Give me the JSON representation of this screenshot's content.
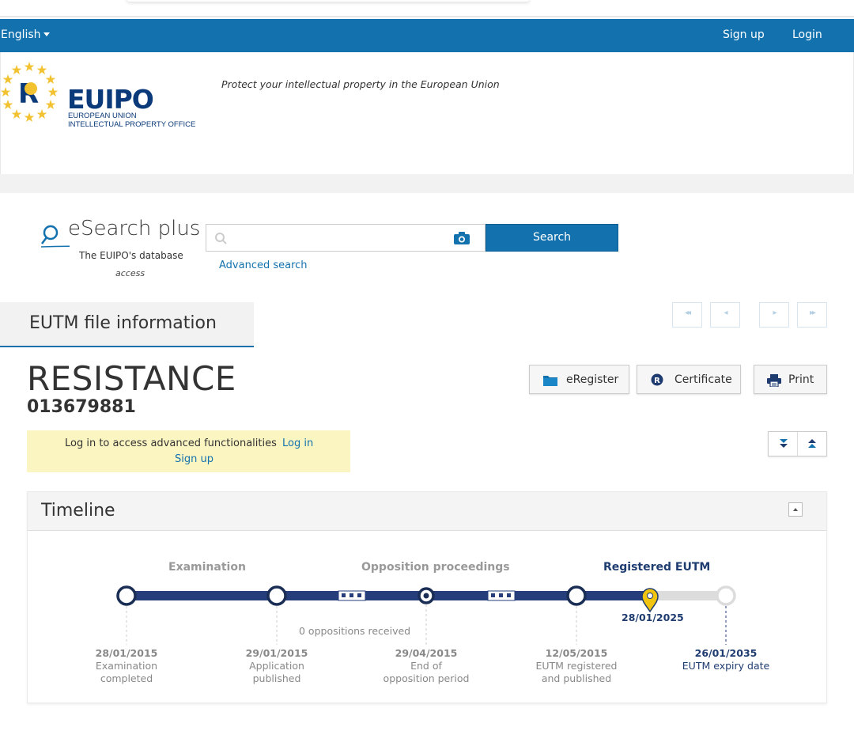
{
  "nav": {
    "language": "English",
    "signup": "Sign up",
    "login": "Login"
  },
  "header": {
    "logo_big_eu": "EU",
    "logo_big_ipo": "IPO",
    "logo_line1": "EUROPEAN UNION",
    "logo_line2": "INTELLECTUAL PROPERTY OFFICE",
    "tagline": "Protect your intellectual property in the European Union"
  },
  "search": {
    "product_title": "eSearch plus",
    "subtitle1": "The EUIPO's database",
    "subtitle2": "access",
    "input_value": "",
    "input_placeholder": "",
    "button_label": "Search",
    "advanced_link": "Advanced search"
  },
  "file": {
    "tab_label": "EUTM file information",
    "name": "RESISTANCE",
    "number": "013679881",
    "buttons": {
      "eregister": "eRegister",
      "certificate": "Certificate",
      "print": "Print"
    }
  },
  "notice": {
    "text": "Log in to access advanced functionalities",
    "login_link": "Log in",
    "signup_link": "Sign up"
  },
  "timeline": {
    "title": "Timeline",
    "phases": [
      "Examination",
      "Opposition proceedings",
      "Registered EUTM"
    ],
    "opposition_note": "0 oppositions received",
    "current_date": "28/01/2025",
    "milestones": [
      {
        "date": "28/01/2015",
        "line1": "Examination",
        "line2": "completed"
      },
      {
        "date": "29/01/2015",
        "line1": "Application",
        "line2": "published"
      },
      {
        "date": "29/04/2015",
        "line1": "End of",
        "line2": "opposition period"
      },
      {
        "date": "12/05/2015",
        "line1": "EUTM registered",
        "line2": "and published"
      },
      {
        "date": "26/01/2035",
        "line1": "EUTM expiry date",
        "line2": ""
      }
    ]
  },
  "colors": {
    "primary": "#1372ae",
    "navy": "#1f3c70",
    "notice_bg": "#fbf5c2",
    "pin": "#f1c40f"
  },
  "icons": {
    "search": "magnifier-icon",
    "camera": "camera-icon",
    "folder": "folder-icon",
    "registered": "registered-r-icon",
    "print": "printer-icon"
  }
}
